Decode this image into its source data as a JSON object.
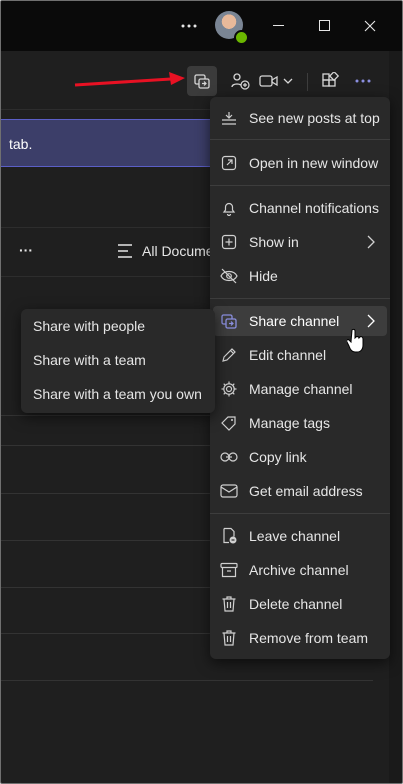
{
  "banner": {
    "text": "tab."
  },
  "list_toolbar": {
    "more": "···",
    "view_label": "All Docume"
  },
  "context_menu": {
    "items": [
      {
        "label": "See new posts at top",
        "icon": "sort-icon"
      },
      {
        "label": "Open in new window",
        "icon": "popout-icon"
      },
      {
        "label": "Channel notifications",
        "icon": "bell-icon"
      },
      {
        "label": "Show in",
        "icon": "plus-box-icon",
        "submenu": true
      },
      {
        "label": "Hide",
        "icon": "eye-off-icon"
      },
      {
        "label": "Share channel",
        "icon": "share-channel-icon",
        "submenu": true,
        "active": true
      },
      {
        "label": "Edit channel",
        "icon": "pencil-icon"
      },
      {
        "label": "Manage channel",
        "icon": "gear-icon"
      },
      {
        "label": "Manage tags",
        "icon": "tag-icon"
      },
      {
        "label": "Copy link",
        "icon": "link-icon"
      },
      {
        "label": "Get email address",
        "icon": "mail-icon"
      },
      {
        "label": "Leave channel",
        "icon": "leave-icon"
      },
      {
        "label": "Archive channel",
        "icon": "archive-icon"
      },
      {
        "label": "Delete channel",
        "icon": "trash-icon"
      },
      {
        "label": "Remove from team",
        "icon": "trash-icon"
      }
    ]
  },
  "share_submenu": {
    "items": [
      {
        "label": "Share with people"
      },
      {
        "label": "Share with a team"
      },
      {
        "label": "Share with a team you own"
      }
    ]
  },
  "colors": {
    "accent": "#5b5fc7",
    "annotation_arrow": "#e81123",
    "presence": "#6bb700"
  }
}
